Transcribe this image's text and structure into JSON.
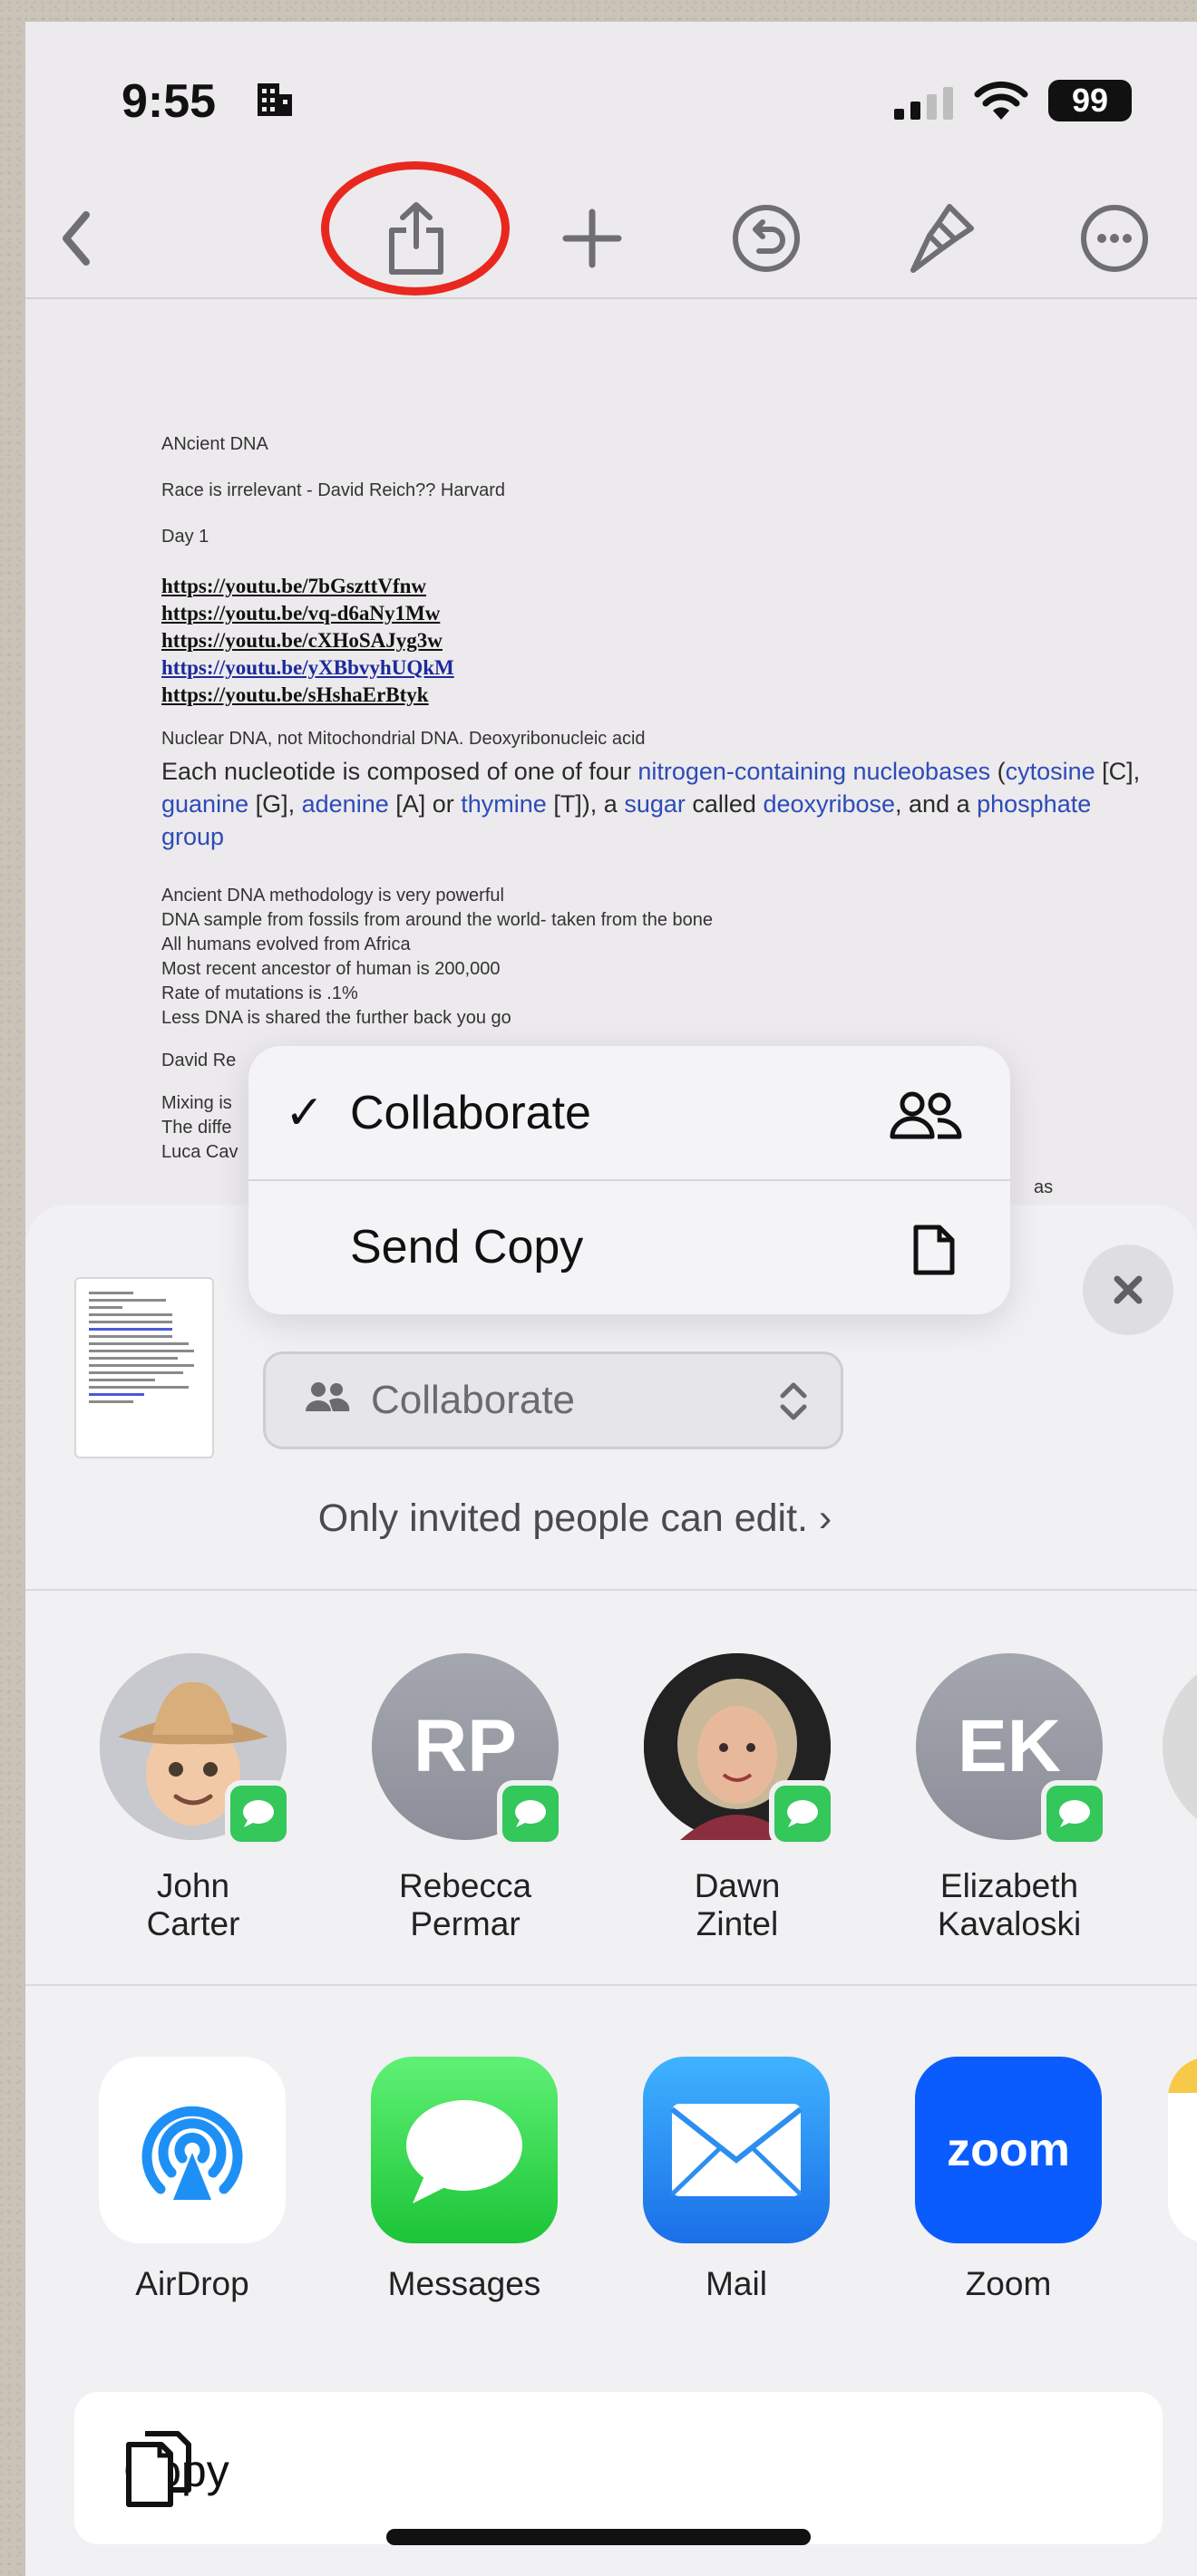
{
  "status_bar": {
    "time": "9:55",
    "battery": "99"
  },
  "document": {
    "lines": [
      "ANcient DNA",
      "Race is irrelevant - David Reich?? Harvard",
      "Day 1"
    ],
    "links": [
      "https://youtu.be/7bGszttVfnw",
      "https://youtu.be/vq-d6aNy1Mw",
      "https://youtu.be/cXHoSAJyg3w",
      "https://youtu.be/yXBbvyhUQkM",
      "https://youtu.be/sHshaErBtyk"
    ],
    "nuclear_line": "Nuclear DNA, not Mitochondrial DNA. Deoxyribonucleic acid",
    "big_text_1": "Each nucleotide is composed of one of four ",
    "big_link_1": "nitrogen-containing nucleobases",
    "big_text_2": " (",
    "big_link_2": "cytosine",
    "big_text_3": " [C], ",
    "big_link_3": "guanine",
    "big_text_4": " [G], ",
    "big_link_4": "adenine",
    "big_text_5": " [A] or ",
    "big_link_5": "thymine",
    "big_text_6": " [T]), a ",
    "big_link_6": "sugar",
    "big_text_7": " called ",
    "big_link_7": "deoxyribose",
    "big_text_8": ", and a ",
    "big_link_8": "phosphate group",
    "list": [
      "Ancient DNA methodology is very powerful",
      "DNA sample from fossils from around the world- taken from the bone",
      "All humans evolved from Africa",
      "Most recent ancestor of human is 200,000",
      "Rate of mutations is .1%",
      "Less DNA is shared the further back you go"
    ],
    "partial": [
      "David Re",
      "Mixing is",
      "The diffe",
      "Luca Cav"
    ],
    "partial_right": "as"
  },
  "menu": {
    "collaborate": "Collaborate",
    "send_copy": "Send Copy",
    "check": "✓"
  },
  "share_sheet": {
    "mode_select": "Collaborate",
    "permissions": "Only invited people can edit. ›",
    "people": [
      {
        "name_1": "John",
        "name_2": "Carter",
        "initials": ""
      },
      {
        "name_1": "Rebecca",
        "name_2": "Permar",
        "initials": "RP"
      },
      {
        "name_1": "Dawn",
        "name_2": "Zintel",
        "initials": ""
      },
      {
        "name_1": "Elizabeth",
        "name_2": "Kavaloski",
        "initials": "EK"
      }
    ],
    "apps": [
      {
        "label": "AirDrop"
      },
      {
        "label": "Messages"
      },
      {
        "label": "Mail"
      },
      {
        "label": "Zoom",
        "icon_text": "zoom"
      }
    ],
    "copy_label": "Copy"
  },
  "colors": {
    "annotation": "#e8281f",
    "messages_green": "#34c759",
    "mail_blue": "#1a8cf3",
    "zoom_blue": "#0b5cff",
    "airdrop_blue": "#1e90f5"
  }
}
